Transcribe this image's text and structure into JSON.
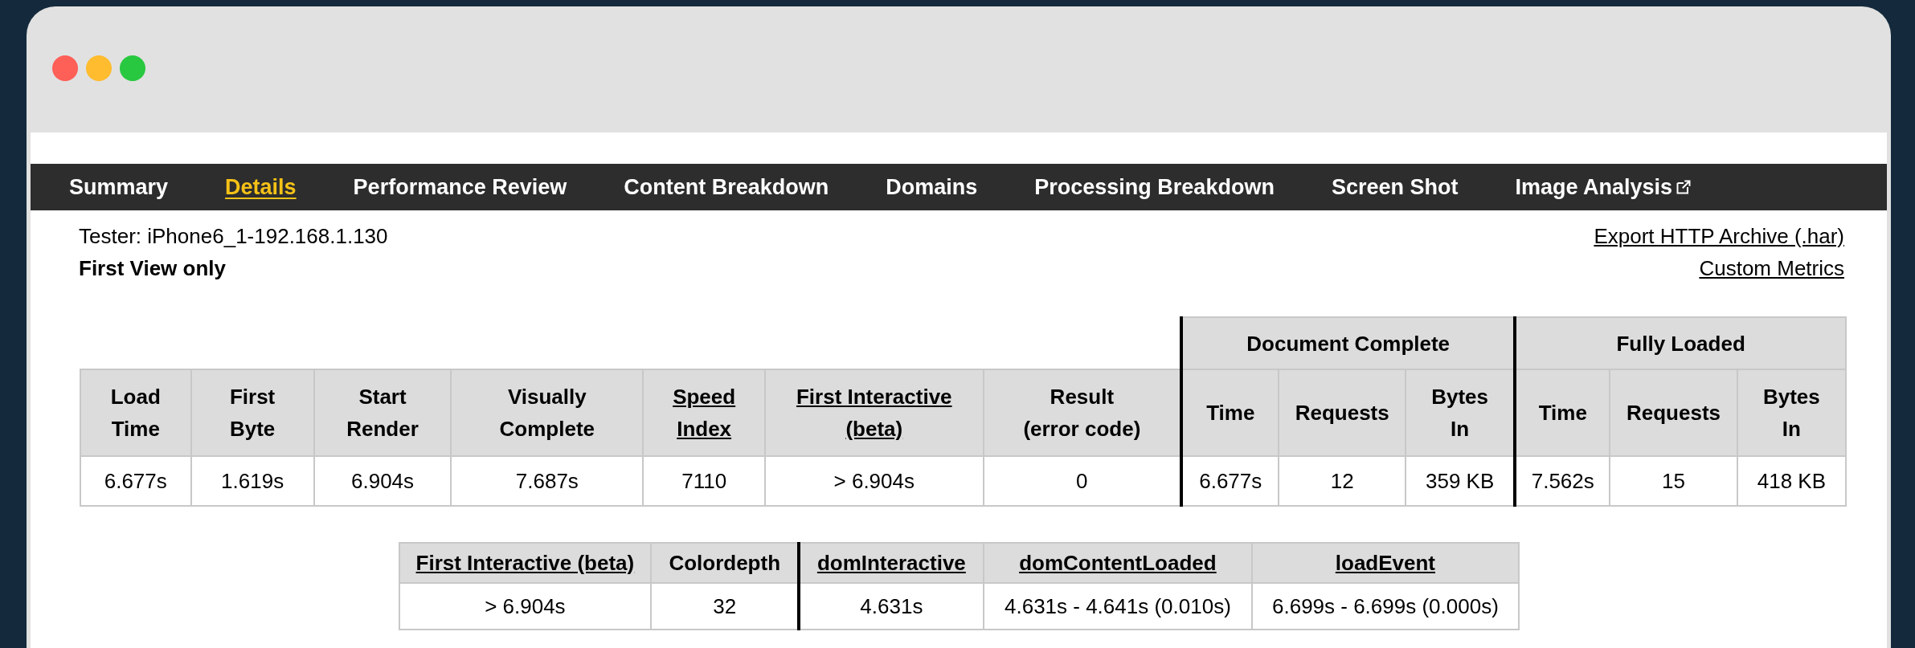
{
  "tabs": [
    {
      "label": "Summary",
      "selected": false,
      "external": false
    },
    {
      "label": "Details",
      "selected": true,
      "external": false
    },
    {
      "label": "Performance Review",
      "selected": false,
      "external": false
    },
    {
      "label": "Content Breakdown",
      "selected": false,
      "external": false
    },
    {
      "label": "Domains",
      "selected": false,
      "external": false
    },
    {
      "label": "Processing Breakdown",
      "selected": false,
      "external": false
    },
    {
      "label": "Screen Shot",
      "selected": false,
      "external": false
    },
    {
      "label": "Image Analysis",
      "selected": false,
      "external": true
    }
  ],
  "tester": "Tester: iPhone6_1-192.168.1.130",
  "view": "First View only",
  "links": [
    "Export HTTP Archive (.har)",
    "Custom Metrics"
  ],
  "summary_table": {
    "columns": [
      {
        "lines": [
          "Load",
          "Time"
        ],
        "link": false
      },
      {
        "lines": [
          "First",
          "Byte"
        ],
        "link": false
      },
      {
        "lines": [
          "Start",
          "Render"
        ],
        "link": false
      },
      {
        "lines": [
          "Visually",
          "Complete"
        ],
        "link": false
      },
      {
        "lines": [
          "Speed",
          "Index"
        ],
        "link": true
      },
      {
        "lines": [
          "First Interactive",
          "(beta)"
        ],
        "link": true
      },
      {
        "lines": [
          "Result",
          "(error code)"
        ],
        "link": false
      }
    ],
    "groups": [
      {
        "title": "Document Complete",
        "columns": [
          {
            "lines": [
              "Time"
            ],
            "link": false
          },
          {
            "lines": [
              "Requests"
            ],
            "link": false
          },
          {
            "lines": [
              "Bytes",
              "In"
            ],
            "link": false
          }
        ]
      },
      {
        "title": "Fully Loaded",
        "columns": [
          {
            "lines": [
              "Time"
            ],
            "link": false
          },
          {
            "lines": [
              "Requests"
            ],
            "link": false
          },
          {
            "lines": [
              "Bytes",
              "In"
            ],
            "link": false
          }
        ]
      }
    ],
    "row": [
      "6.677s",
      "1.619s",
      "6.904s",
      "7.687s",
      "7110",
      "> 6.904s",
      "0",
      "6.677s",
      "12",
      "359 KB",
      "7.562s",
      "15",
      "418 KB"
    ]
  },
  "metrics_table": {
    "columns": [
      {
        "label": "First Interactive (beta)",
        "link": true,
        "divider_before": false
      },
      {
        "label": "Colordepth",
        "link": false,
        "divider_before": false
      },
      {
        "label": "domInteractive",
        "link": true,
        "divider_before": true
      },
      {
        "label": "domContentLoaded",
        "link": true,
        "divider_before": false
      },
      {
        "label": "loadEvent",
        "link": true,
        "divider_before": false
      }
    ],
    "row": [
      "> 6.904s",
      "32",
      "4.631s",
      "4.631s - 4.641s (0.010s)",
      "6.699s - 6.699s (0.000s)"
    ]
  }
}
